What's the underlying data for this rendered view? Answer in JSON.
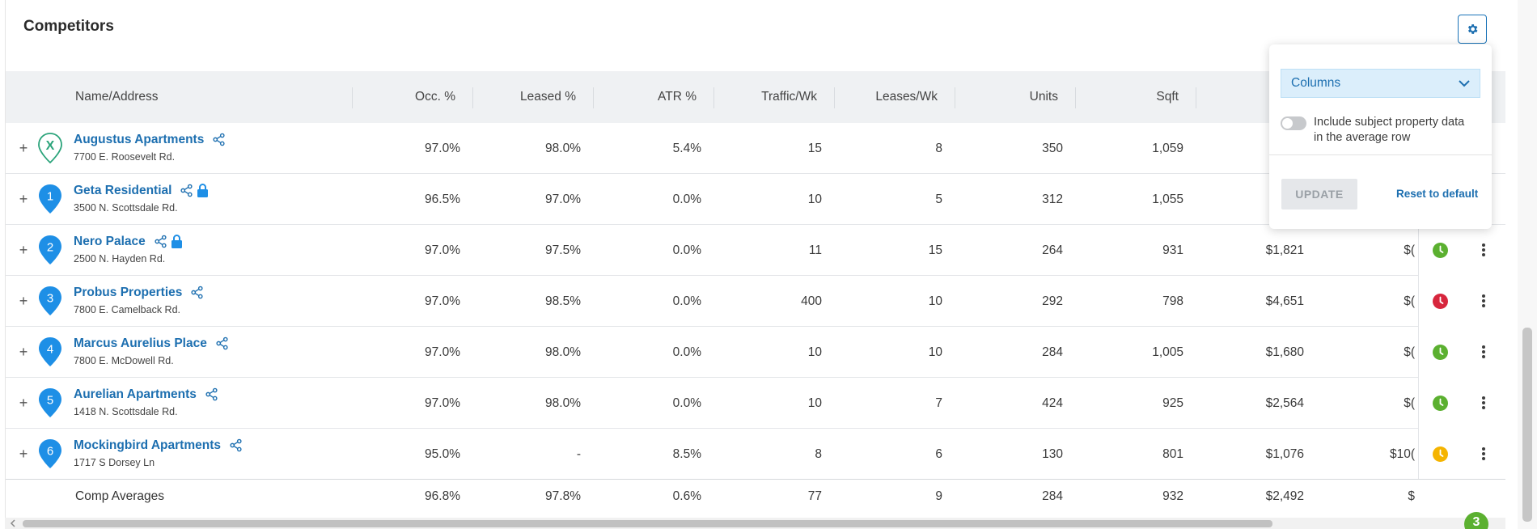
{
  "panel": {
    "title": "Competitors"
  },
  "columns": [
    "Name/Address",
    "Occ. %",
    "Leased %",
    "ATR %",
    "Traffic/Wk",
    "Leases/Wk",
    "Units",
    "Sqft"
  ],
  "rows": [
    {
      "pin": "X",
      "pin_type": "subject",
      "name": "Augustus Apartments",
      "address": "7700 E. Roosevelt Rd.",
      "locked": false,
      "occ": "97.0%",
      "leased": "98.0%",
      "atr": "5.4%",
      "traffic": "15",
      "leases": "8",
      "units": "350",
      "sqft": "1,059",
      "rent": "$",
      "extra": "",
      "status": ""
    },
    {
      "pin": "1",
      "pin_type": "comp",
      "name": "Geta Residential",
      "address": "3500 N. Scottsdale Rd.",
      "locked": true,
      "occ": "96.5%",
      "leased": "97.0%",
      "atr": "0.0%",
      "traffic": "10",
      "leases": "5",
      "units": "312",
      "sqft": "1,055",
      "rent": "$",
      "extra": "",
      "status": ""
    },
    {
      "pin": "2",
      "pin_type": "comp",
      "name": "Nero Palace",
      "address": "2500 N. Hayden Rd.",
      "locked": true,
      "occ": "97.0%",
      "leased": "97.5%",
      "atr": "0.0%",
      "traffic": "11",
      "leases": "15",
      "units": "264",
      "sqft": "931",
      "rent": "$1,821",
      "extra": "$(",
      "status": "green"
    },
    {
      "pin": "3",
      "pin_type": "comp",
      "name": "Probus Properties",
      "address": "7800 E. Camelback Rd.",
      "locked": false,
      "occ": "97.0%",
      "leased": "98.5%",
      "atr": "0.0%",
      "traffic": "400",
      "leases": "10",
      "units": "292",
      "sqft": "798",
      "rent": "$4,651",
      "extra": "$(",
      "status": "red"
    },
    {
      "pin": "4",
      "pin_type": "comp",
      "name": "Marcus Aurelius Place",
      "address": "7800 E. McDowell Rd.",
      "locked": false,
      "occ": "97.0%",
      "leased": "98.0%",
      "atr": "0.0%",
      "traffic": "10",
      "leases": "10",
      "units": "284",
      "sqft": "1,005",
      "rent": "$1,680",
      "extra": "$(",
      "status": "green"
    },
    {
      "pin": "5",
      "pin_type": "comp",
      "name": "Aurelian Apartments",
      "address": "1418 N. Scottsdale Rd.",
      "locked": false,
      "occ": "97.0%",
      "leased": "98.0%",
      "atr": "0.0%",
      "traffic": "10",
      "leases": "7",
      "units": "424",
      "sqft": "925",
      "rent": "$2,564",
      "extra": "$(",
      "status": "green"
    },
    {
      "pin": "6",
      "pin_type": "comp",
      "name": "Mockingbird Apartments",
      "address": "1717 S Dorsey Ln",
      "locked": false,
      "occ": "95.0%",
      "leased": "-",
      "atr": "8.5%",
      "traffic": "8",
      "leases": "6",
      "units": "130",
      "sqft": "801",
      "rent": "$1,076",
      "extra": "$10(",
      "status": "yellow"
    }
  ],
  "averages": {
    "label": "Comp Averages",
    "occ": "96.8%",
    "leased": "97.8%",
    "atr": "0.6%",
    "traffic": "77",
    "leases": "9",
    "units": "284",
    "sqft": "932",
    "rent": "$2,492",
    "extra": "$"
  },
  "settings": {
    "columns_label": "Columns",
    "toggle_label": "Include subject property data in the average row",
    "toggle_on": false,
    "update_label": "UPDATE",
    "reset_label": "Reset to default"
  },
  "notification_count": "3",
  "colors": {
    "accent": "#1d6fb0",
    "pin": "#1e8fe6",
    "green": "#5bb030",
    "red": "#d7263d",
    "yellow": "#f5b400"
  }
}
